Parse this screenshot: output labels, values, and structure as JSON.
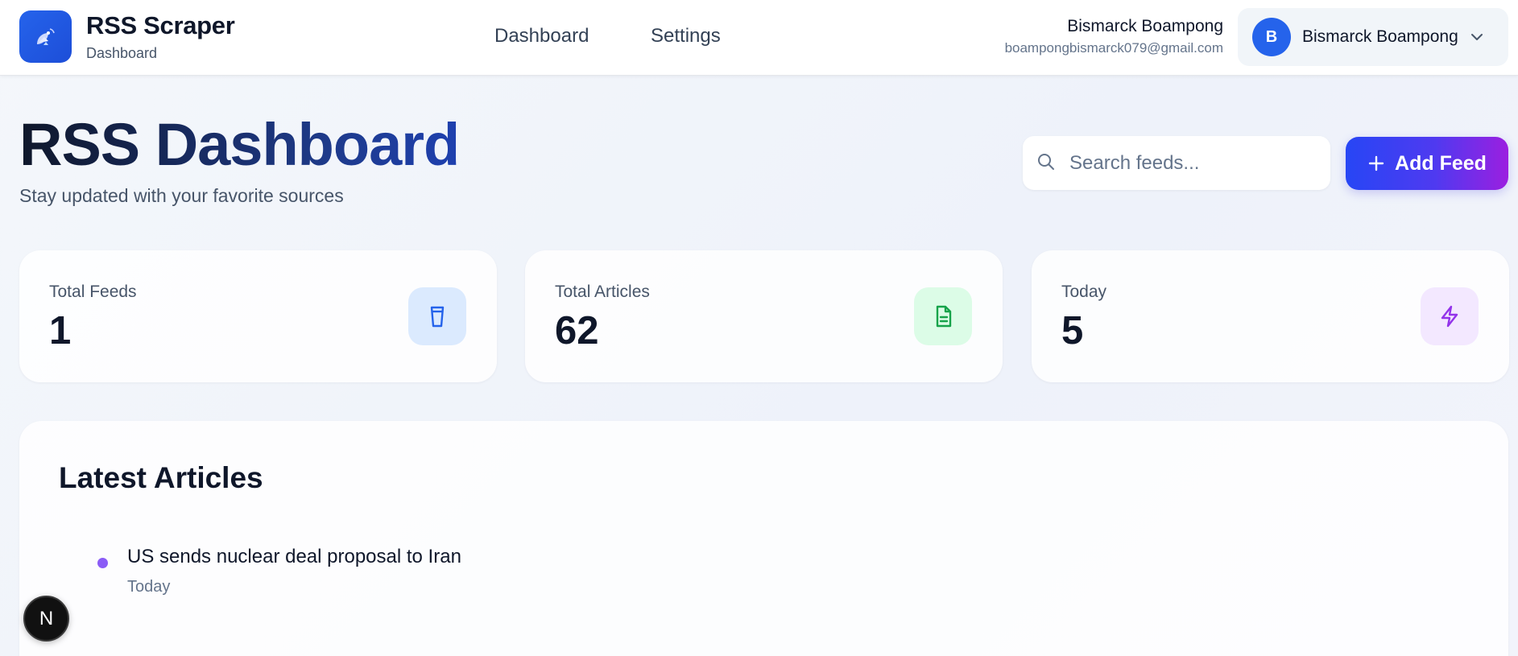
{
  "header": {
    "brand_title": "RSS Scraper",
    "brand_subtitle": "Dashboard",
    "nav": [
      {
        "label": "Dashboard"
      },
      {
        "label": "Settings"
      }
    ],
    "user": {
      "name": "Bismarck Boampong",
      "email": "boampongbismarck079@gmail.com",
      "avatar_initial": "B",
      "menu_name": "Bismarck Boampong"
    },
    "icons": {
      "logo": "satellite-dish-icon",
      "user_menu": "chevron-down-icon"
    }
  },
  "page": {
    "title": "RSS Dashboard",
    "subtitle": "Stay updated with your favorite sources",
    "search": {
      "placeholder": "Search feeds...",
      "value": ""
    },
    "add_feed_label": "Add Feed"
  },
  "stats": [
    {
      "label": "Total Feeds",
      "value": "1",
      "icon": "cup-icon",
      "color": "#2563eb"
    },
    {
      "label": "Total Articles",
      "value": "62",
      "icon": "document-icon",
      "color": "#16a34a"
    },
    {
      "label": "Today",
      "value": "5",
      "icon": "lightning-icon",
      "color": "#9333ea"
    }
  ],
  "articles": {
    "title": "Latest Articles",
    "items": [
      {
        "title": "US sends nuclear deal proposal to Iran",
        "date": "Today"
      }
    ]
  },
  "badge": {
    "label": "N"
  },
  "colors": {
    "accent": "#2563eb",
    "add_feed_gradient_start": "#2746f5",
    "add_feed_gradient_end": "#9b1fe0",
    "article_dot": "#8b5cf6"
  }
}
